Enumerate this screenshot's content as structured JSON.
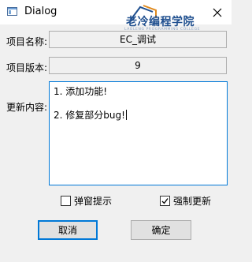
{
  "window": {
    "title": "Dialog",
    "watermark_text": "老冷编程学院",
    "watermark_subtext": "LAOLENG PROGRAMMING COLLEGE"
  },
  "form": {
    "project_name_label": "项目名称:",
    "project_name_value": "EC_调试",
    "project_version_label": "项目版本:",
    "project_version_value": "9",
    "update_content_label": "更新内容:",
    "update_content_lines": [
      "1. 添加功能!",
      "2. 修复部分bug!"
    ]
  },
  "options": {
    "popup_hint_label": "弹窗提示",
    "popup_hint_checked": false,
    "force_update_label": "强制更新",
    "force_update_checked": true
  },
  "buttons": {
    "cancel_label": "取消",
    "ok_label": "确定"
  },
  "colors": {
    "accent": "#0078d7",
    "watermark": "#1f4f8f"
  }
}
